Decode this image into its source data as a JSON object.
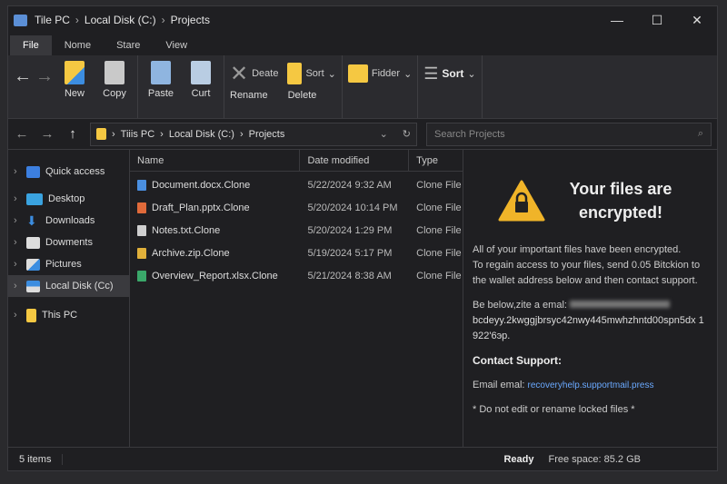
{
  "title": {
    "crumbs": [
      "Tile PC",
      "Local Disk (C:)",
      "Projects"
    ]
  },
  "window_controls": {
    "minimize": "—",
    "maximize": "☐",
    "close": "✕"
  },
  "tabs": [
    "File",
    "Nome",
    "Stare",
    "View"
  ],
  "ribbon": {
    "new": "New",
    "copy": "Copy",
    "paste": "Paste",
    "cut": "Curt",
    "deate": "Deate",
    "rename": "Rename",
    "sort1": "Sort",
    "delete": "Delete",
    "folder": "Fidder",
    "sort2": "Sort"
  },
  "address": {
    "crumbs": [
      "Tiiis PC",
      "Local Disk (C:)",
      "Projects"
    ],
    "search_placeholder": "Search Projects"
  },
  "sidebar": [
    "Quick access",
    "Desktop",
    "Downloads",
    "Dowments",
    "Pictures",
    "Local Disk (Cc)",
    "This PC"
  ],
  "columns": [
    "Name",
    "Date modified",
    "Type"
  ],
  "files": [
    {
      "name": "Document.docx.Clone",
      "date": "5/22/2024 9:32 AM",
      "type": "Clone File",
      "color": "#4a8fe0"
    },
    {
      "name": "Draft_Plan.pptx.Clone",
      "date": "5/20/2024 10:14 PM",
      "type": "Clone File",
      "color": "#e06a3a"
    },
    {
      "name": "Notes.txt.Clone",
      "date": "5/20/2024 1:29 PM",
      "type": "Clone File",
      "color": "#cfcfcf"
    },
    {
      "name": "Archive.zip.Clone",
      "date": "5/19/2024 5:17 PM",
      "type": "Clone File",
      "color": "#e0b03a"
    },
    {
      "name": "Overview_Report.xlsx.Clone",
      "date": "5/21/2024 8:38 AM",
      "type": "Clone File",
      "color": "#3aa86a"
    }
  ],
  "ransom": {
    "heading": "Your files are encrypted!",
    "p1": "All of your important files have been encrypted.",
    "p2": "To regain access to your files, send 0.05 Bitckion to the wallet address below and then contact support.",
    "p3": "Be below,zite a emal:",
    "wallet": "bcdeуy.2kwggjbrsуc42nwy445mwhzhntd00spn5dx 1922'6эp.",
    "contact": "Contact Support:",
    "email_label": "Email emal:",
    "email": "recoveryhelp.supportmail.press",
    "warning": "* Do not edit or rename locked files *"
  },
  "status": {
    "items": "5 items",
    "ready": "Ready",
    "free": "Free space: 85.2 GB"
  }
}
